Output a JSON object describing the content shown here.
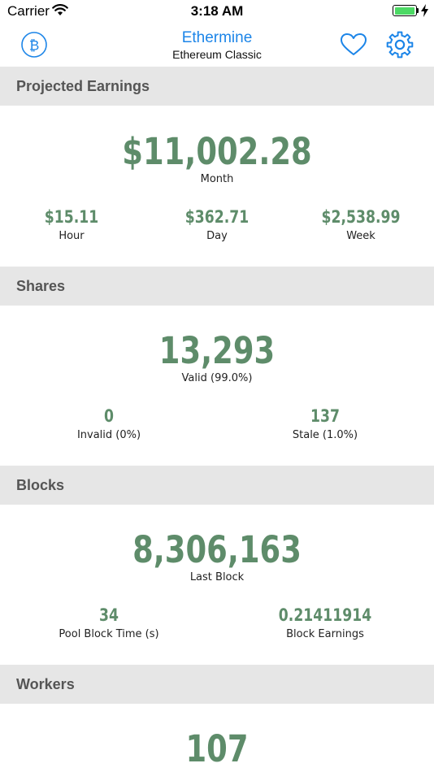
{
  "status_bar": {
    "carrier": "Carrier",
    "time": "3:18 AM",
    "battery_level": 1.0
  },
  "nav": {
    "title": "Ethermine",
    "subtitle": "Ethereum Classic",
    "icons": [
      "bitcoin-icon",
      "heart-icon",
      "gear-icon"
    ],
    "accent": "#1c85e8"
  },
  "colors": {
    "value": "#5e8c6a",
    "header_bg": "#e6e6e6"
  },
  "sections": {
    "earnings": {
      "title": "Projected Earnings",
      "main": {
        "value": "$11,002.28",
        "label": "Month"
      },
      "items": [
        {
          "value": "$15.11",
          "label": "Hour"
        },
        {
          "value": "$362.71",
          "label": "Day"
        },
        {
          "value": "$2,538.99",
          "label": "Week"
        }
      ]
    },
    "shares": {
      "title": "Shares",
      "main": {
        "value": "13,293",
        "label": "Valid (99.0%)"
      },
      "items": [
        {
          "value": "0",
          "label": "Invalid (0%)"
        },
        {
          "value": "137",
          "label": "Stale (1.0%)"
        }
      ]
    },
    "blocks": {
      "title": "Blocks",
      "main": {
        "value": "8,306,163",
        "label": "Last Block"
      },
      "items": [
        {
          "value": "34",
          "label": "Pool Block Time (s)"
        },
        {
          "value": "0.21411914",
          "label": "Block Earnings"
        }
      ]
    },
    "workers": {
      "title": "Workers",
      "main": {
        "value": "107"
      }
    }
  }
}
